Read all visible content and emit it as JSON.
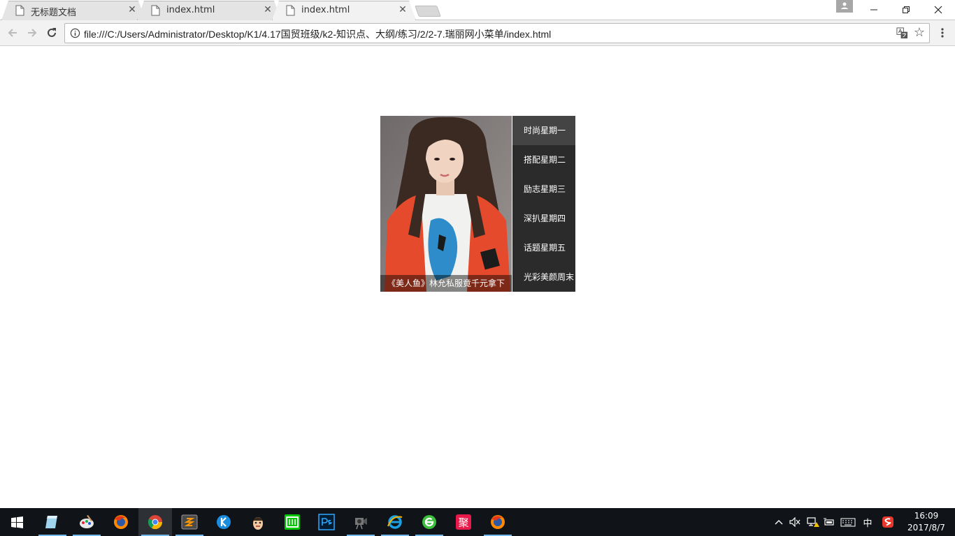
{
  "browser": {
    "tabs": [
      {
        "title": "无标题文档",
        "active": false
      },
      {
        "title": "index.html",
        "active": false
      },
      {
        "title": "index.html",
        "active": true
      }
    ],
    "url": "file:///C:/Users/Administrator/Desktop/K1/4.17国贸班级/k2-知识点、大纲/练习/2/2-7.瑞丽网小菜单/index.html"
  },
  "page": {
    "caption": "《美人鱼》林允私服竟千元拿下",
    "menu": [
      {
        "label": "时尚星期一",
        "active": true
      },
      {
        "label": "搭配星期二",
        "active": false
      },
      {
        "label": "励志星期三",
        "active": false
      },
      {
        "label": "深扒星期四",
        "active": false
      },
      {
        "label": "话题星期五",
        "active": false
      },
      {
        "label": "光彩美颜周末",
        "active": false
      }
    ]
  },
  "taskbar": {
    "tray_ime": "中",
    "time": "16:09",
    "date": "2017/8/7"
  },
  "colors": {
    "menu_bg": "#2b2b2b",
    "menu_active_bg": "#444444",
    "taskbar_bg": "#101418",
    "taskbar_indicator": "#76b9ed"
  }
}
